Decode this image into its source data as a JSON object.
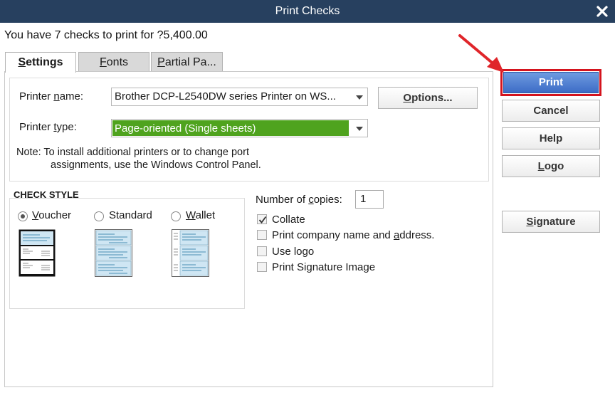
{
  "window": {
    "title": "Print Checks",
    "close_icon": "close-icon"
  },
  "summary": "You have 7 checks to print for ?5,400.00",
  "tabs": [
    {
      "label": "Settings",
      "accel": "S",
      "rest": "ettings",
      "active": true
    },
    {
      "label": "Fonts",
      "accel": "F",
      "rest": "onts",
      "active": false
    },
    {
      "label": "Partial Pa...",
      "accel": "P",
      "rest": "artial Pa...",
      "active": false
    }
  ],
  "printer": {
    "name_label_pre": "Printer ",
    "name_label_accel": "n",
    "name_label_post": "ame:",
    "name_value": "Brother DCP-L2540DW series Printer on WS...",
    "type_label_pre": "Printer ",
    "type_label_accel": "t",
    "type_label_post": "ype:",
    "type_value": "Page-oriented (Single sheets)",
    "type_highlight": "#4fa31e",
    "options_label_accel": "O",
    "options_label_rest": "ptions...",
    "note_line1": "Note: To install additional printers or to change port",
    "note_line2": "assignments, use the Windows Control Panel."
  },
  "check_style": {
    "heading": "CHECK STYLE",
    "options": [
      {
        "label": "Voucher",
        "accel": "V",
        "rest": "oucher",
        "selected": true
      },
      {
        "label": "Standard",
        "accel": "",
        "rest": "Standard",
        "selected": false
      },
      {
        "label": "Wallet",
        "accel": "W",
        "rest": "allet",
        "selected": false
      }
    ]
  },
  "copies": {
    "label_pre": "Number of ",
    "label_accel": "c",
    "label_post": "opies:",
    "value": "1"
  },
  "checkboxes": [
    {
      "label": "Collate",
      "checked": true
    },
    {
      "label_pre": "Print company name and ",
      "label_accel": "a",
      "label_post": "ddress.",
      "label": "Print company name and address.",
      "checked": false
    },
    {
      "label": "Use logo",
      "checked": false
    },
    {
      "label": "Print Signature Image",
      "checked": false
    }
  ],
  "buttons": {
    "print": "Print",
    "cancel": "Cancel",
    "help": "Help",
    "logo_accel": "L",
    "logo_rest": "ogo",
    "signature_accel": "S",
    "signature_rest": "ignature"
  },
  "colors": {
    "titlebar": "#27405f",
    "primary": "#3d6cc6",
    "highlight_border": "#d4141e",
    "arrow": "#e0252a"
  }
}
